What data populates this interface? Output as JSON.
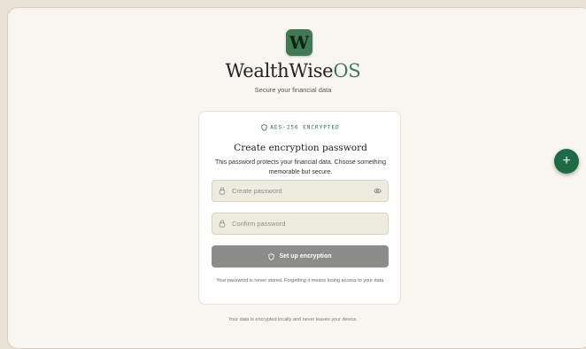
{
  "app": {
    "logo_letter": "W",
    "name_main": "WealthWise",
    "name_suffix": "OS",
    "tagline": "Secure your financial data"
  },
  "card": {
    "badge": "AES-256 ENCRYPTED",
    "title": "Create encryption password",
    "description": "This password protects your financial data. Choose something memorable but secure.",
    "password_field": {
      "placeholder": "Create password",
      "value": ""
    },
    "confirm_field": {
      "placeholder": "Confirm password",
      "value": ""
    },
    "submit_label": "Set up encryption",
    "note": "Your password is never stored. Forgetting it means losing access to your data."
  },
  "footer": "Your data is encrypted locally and never leaves your device.",
  "fab_label": "+",
  "icons": {
    "badge": "shield-icon",
    "password": "lock-icon",
    "toggle": "eye-icon",
    "confirm": "lock-icon",
    "submit": "shield-icon",
    "fab": "plus-icon"
  },
  "colors": {
    "brand_green": "#3f7a55",
    "fab_green": "#1f6a44",
    "button_disabled": "#8c8c8a",
    "background": "#f9f6f1"
  }
}
